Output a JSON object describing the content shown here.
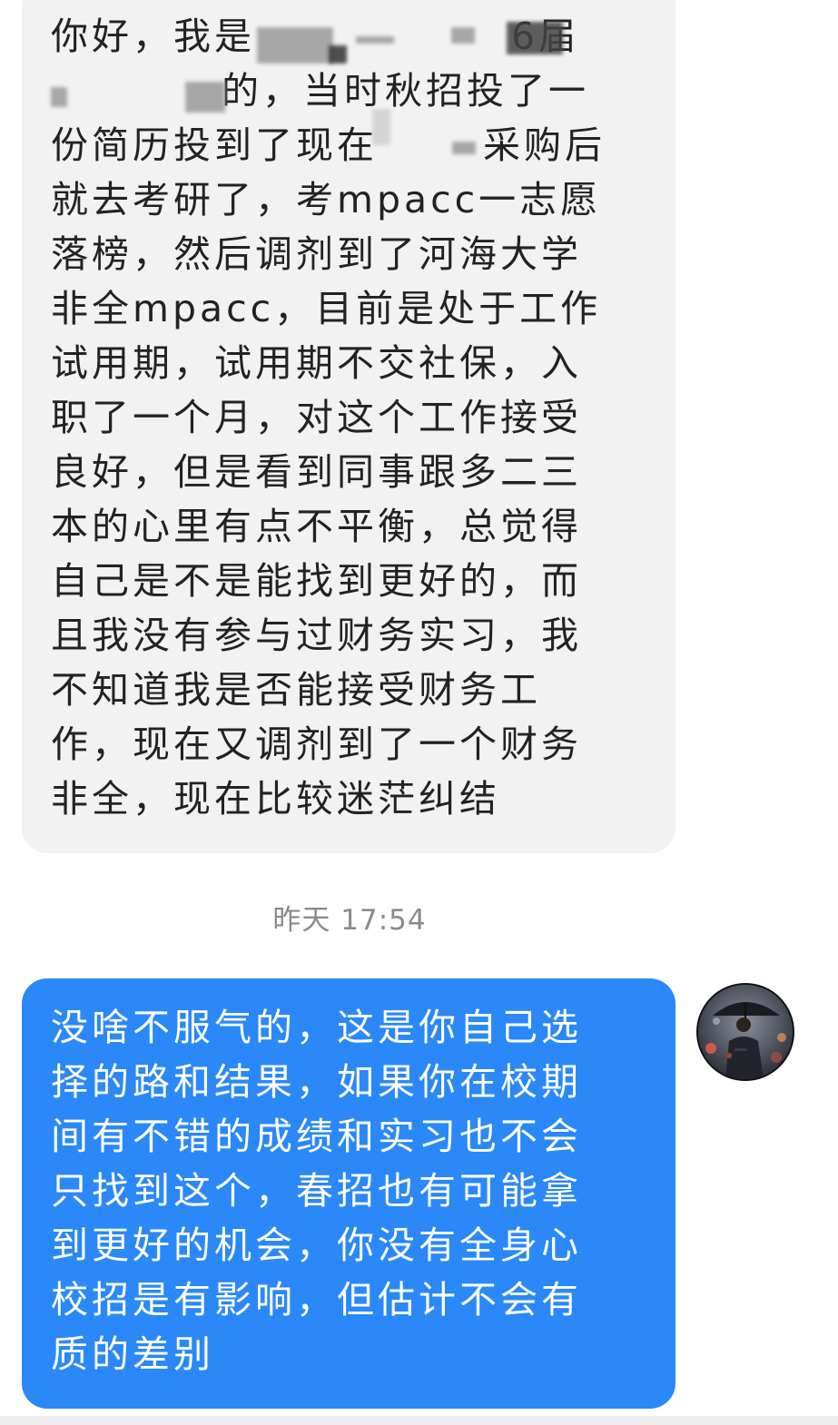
{
  "incoming_message": {
    "lines": [
      "你好，我是",
      "的，当时秋招投了一",
      "份简历投到了现在",
      "就去考研了，考mpacc一志愿",
      "落榜，然后调剂到了河海大学",
      "非全mpacc，目前是处于工作",
      "试用期，试用期不交社保，入",
      "职了一个月，对这个工作接受",
      "良好，但是看到同事跟多二三",
      "本的心里有点不平衡，总觉得",
      "自己是不是能找到更好的，而",
      "且我没有参与过财务实习，我",
      "不知道我是否能接受财务工",
      "作，现在又调剂到了一个财务",
      "非全，现在比较迷茫纠结"
    ],
    "line1_tail": "6届",
    "line3_tail": "采购后",
    "redacted": true
  },
  "timestamp": "昨天 17:54",
  "outgoing_message": {
    "lines": [
      "没啥不服气的，这是你自己选",
      "择的路和结果，如果你在校期",
      "间有不错的成绩和实习也不会",
      "只找到这个，春招也有可能拿",
      "到更好的机会，你没有全身心",
      "校招是有影响，但估计不会有",
      "质的差别"
    ]
  },
  "avatar": {
    "icon": "avatar-umbrella-man"
  },
  "colors": {
    "incoming_bg": "#f2f2f2",
    "outgoing_bg": "#2a88f8",
    "timestamp": "#8a8a8a"
  }
}
